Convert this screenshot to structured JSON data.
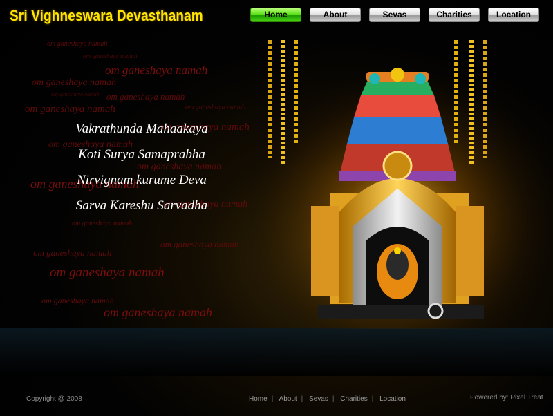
{
  "header": {
    "title": "Sri Vighneswara Devasthanam",
    "nav": [
      {
        "label": "Home",
        "active": true
      },
      {
        "label": "About",
        "active": false
      },
      {
        "label": "Sevas",
        "active": false
      },
      {
        "label": "Charities",
        "active": false
      },
      {
        "label": "Location",
        "active": false
      }
    ]
  },
  "chant": {
    "text": "om ganeshaya namah"
  },
  "verse": {
    "lines": [
      "Vakrathunda Mahaakaya",
      "Koti Surya Samaprabha",
      "Nirvignam kurume Deva",
      "Sarva Kareshu Sarvadha"
    ]
  },
  "footer": {
    "copyright": "Copyright @ 2008",
    "links": [
      "Home",
      "About",
      "Sevas",
      "Charities",
      "Location"
    ],
    "separator": "|",
    "powered_by": "Powered by:  Pixel Treat"
  },
  "colors": {
    "title_yellow": "#ffe600",
    "nav_active_green": "#3fcf10",
    "chant_red": "#5e0b0b",
    "verse_white": "#ffffff"
  }
}
